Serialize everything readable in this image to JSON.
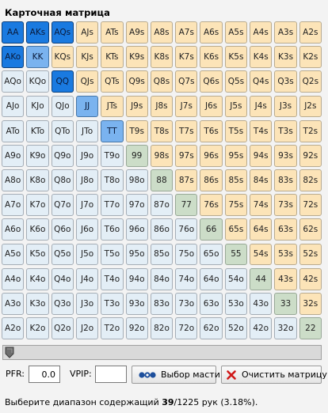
{
  "panel": {
    "title": "Карточная матрица"
  },
  "matrix": {
    "rows": [
      [
        "AA",
        "AKs",
        "AQs",
        "AJs",
        "ATs",
        "A9s",
        "A8s",
        "A7s",
        "A6s",
        "A5s",
        "A4s",
        "A3s",
        "A2s"
      ],
      [
        "AKo",
        "KK",
        "KQs",
        "KJs",
        "KTs",
        "K9s",
        "K8s",
        "K7s",
        "K6s",
        "K5s",
        "K4s",
        "K3s",
        "K2s"
      ],
      [
        "AQo",
        "KQo",
        "QQ",
        "QJs",
        "QTs",
        "Q9s",
        "Q8s",
        "Q7s",
        "Q6s",
        "Q5s",
        "Q4s",
        "Q3s",
        "Q2s"
      ],
      [
        "AJo",
        "KJo",
        "QJo",
        "JJ",
        "JTs",
        "J9s",
        "J8s",
        "J7s",
        "J6s",
        "J5s",
        "J4s",
        "J3s",
        "J2s"
      ],
      [
        "ATo",
        "KTo",
        "QTo",
        "JTo",
        "TT",
        "T9s",
        "T8s",
        "T7s",
        "T6s",
        "T5s",
        "T4s",
        "T3s",
        "T2s"
      ],
      [
        "A9o",
        "K9o",
        "Q9o",
        "J9o",
        "T9o",
        "99",
        "98s",
        "97s",
        "96s",
        "95s",
        "94s",
        "93s",
        "92s"
      ],
      [
        "A8o",
        "K8o",
        "Q8o",
        "J8o",
        "T8o",
        "98o",
        "88",
        "87s",
        "86s",
        "85s",
        "84s",
        "83s",
        "82s"
      ],
      [
        "A7o",
        "K7o",
        "Q7o",
        "J7o",
        "T7o",
        "97o",
        "87o",
        "77",
        "76s",
        "75s",
        "74s",
        "73s",
        "72s"
      ],
      [
        "A6o",
        "K6o",
        "Q6o",
        "J6o",
        "T6o",
        "96o",
        "86o",
        "76o",
        "66",
        "65s",
        "64s",
        "63s",
        "62s"
      ],
      [
        "A5o",
        "K5o",
        "Q5o",
        "J5o",
        "T5o",
        "95o",
        "85o",
        "75o",
        "65o",
        "55",
        "54s",
        "53s",
        "52s"
      ],
      [
        "A4o",
        "K4o",
        "Q4o",
        "J4o",
        "T4o",
        "94o",
        "84o",
        "74o",
        "64o",
        "54o",
        "44",
        "43s",
        "42s"
      ],
      [
        "A3o",
        "K3o",
        "Q3o",
        "J3o",
        "T3o",
        "93o",
        "83o",
        "73o",
        "63o",
        "53o",
        "43o",
        "33",
        "32s"
      ],
      [
        "A2o",
        "K2o",
        "Q2o",
        "J2o",
        "T2o",
        "92o",
        "82o",
        "72o",
        "62o",
        "52o",
        "42o",
        "32o",
        "22"
      ]
    ],
    "selected_dark": [
      "AA",
      "AKs",
      "AQs",
      "AKo",
      "QQ"
    ],
    "selected_light": [
      "KK",
      "JJ",
      "TT"
    ],
    "colors": {
      "suited": "#fce4b8",
      "offsuit": "#e3eef6",
      "pair": "#ccddc8",
      "selected_dark": "#1a7ae0",
      "selected_light": "#7ab3ef"
    }
  },
  "range_slider": {
    "value_fraction": 0
  },
  "stats": {
    "pfr_label": "PFR:",
    "pfr_value": "0.0",
    "vpip_label": "VPIP:",
    "vpip_value": ""
  },
  "buttons": {
    "suit_select": {
      "label": "Выбор масти",
      "icon": "suit-select-icon"
    },
    "clear_matrix": {
      "label": "Очистить матрицу",
      "icon": "close-x-icon"
    }
  },
  "status": {
    "prefix": "Выберите диапазон содержащий ",
    "selected_count": "39",
    "total_suffix": "/1225 рук (3.18%)."
  }
}
